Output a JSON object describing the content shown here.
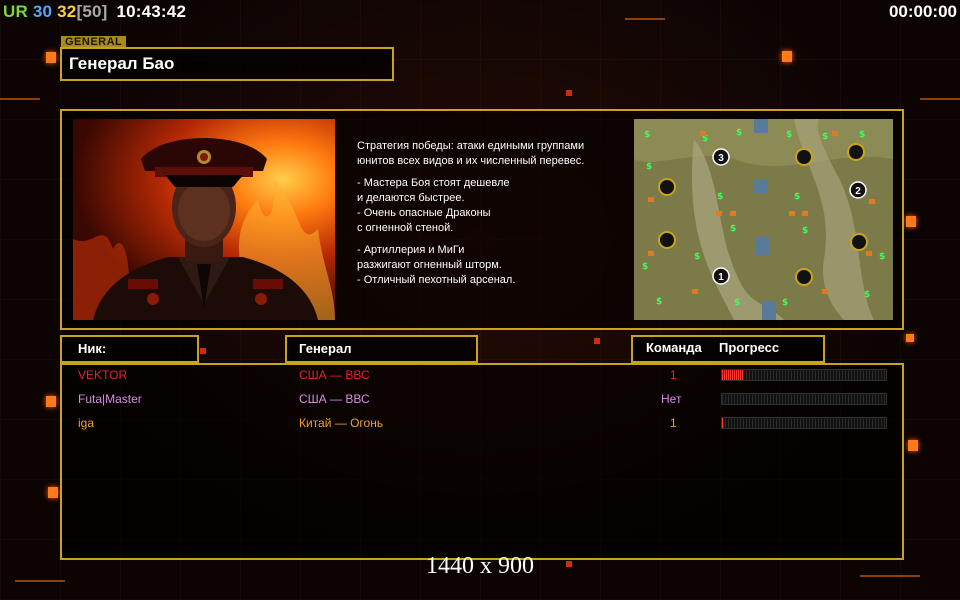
{
  "hud": {
    "ur": "UR",
    "val1": "30",
    "val2": "32",
    "val3": "[50]",
    "clock": "10:43:42",
    "timer": "00:00:00"
  },
  "general": {
    "tag": "GENERAL",
    "name": "Генерал Бао"
  },
  "description": [
    "Стратегия победы: атаки едиными группами",
    "юнитов всех видов и их численный перевес.",
    "",
    "- Мастера Боя стоят дешевле",
    "и делаются быстрее.",
    "- Очень опасные Драконы",
    "с огненной стеной.",
    "",
    "- Артиллерия и МиГи",
    "разжигают огненный шторм.",
    "- Отличный пехотный арсенал."
  ],
  "table": {
    "nick_header": "Ник:",
    "general_header": "Генерал",
    "team_header": "Команда",
    "progress_header": "Прогресс"
  },
  "players": [
    {
      "nick": "VEKTOR",
      "general": "США — ВВС",
      "team": "1",
      "progress": 0.13,
      "color": "#e8202a"
    },
    {
      "nick": "Futa|Master",
      "general": "США — ВВС",
      "team": "Нет",
      "progress": 0.0,
      "color": "#d98ce6"
    },
    {
      "nick": "iga",
      "general": "Китай — Огонь",
      "team": "1",
      "progress": 0.01,
      "color": "#f0a030"
    }
  ],
  "minimap": {
    "player_starts": [
      "1",
      "2",
      "3"
    ]
  },
  "resolution": "1440 x 900",
  "colors": {
    "accent_gold": "#c9a41a",
    "hud_ur": "#7bd63c",
    "hud_blue": "#4fa7ff",
    "hud_yellow": "#ffd23a"
  }
}
